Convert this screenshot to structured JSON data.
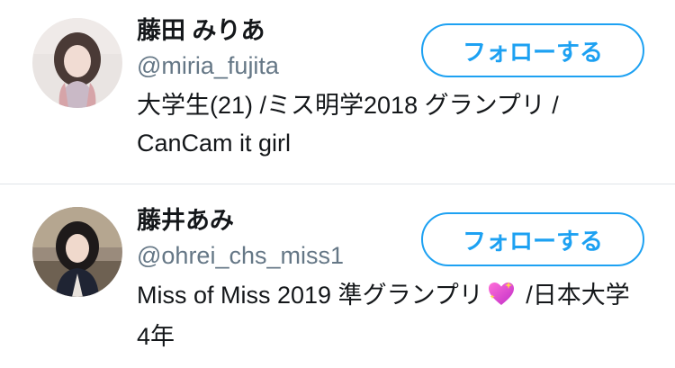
{
  "users": [
    {
      "display_name": "藤田 みりあ",
      "handle": "@miria_fujita",
      "bio_text": "大学生(21) /ミス明学2018 グランプリ / CanCam it girl",
      "follow_label": "フォローする"
    },
    {
      "display_name": "藤井あみ",
      "handle": "@ohrei_chs_miss1",
      "bio_before_emoji": "Miss of Miss 2019 準グランプリ",
      "bio_emoji": "sparkling-heart-icon",
      "bio_after_emoji": " /日本大学4年",
      "follow_label": "フォローする"
    }
  ],
  "colors": {
    "accent": "#1da1f2",
    "secondary_text": "#657786",
    "primary_text": "#14171a",
    "divider": "#dfe3e8"
  }
}
